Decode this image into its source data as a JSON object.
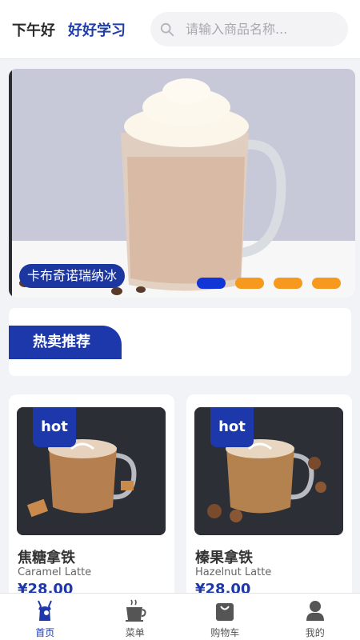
{
  "header": {
    "greeting": "下午好",
    "motto": "好好学习",
    "search_placeholder": "请输入商品名称..."
  },
  "banner": {
    "caption": "卡布奇诺瑞纳冰",
    "slide_count": 4,
    "active_slide": 1
  },
  "hot_section": {
    "title": "热卖推荐"
  },
  "products": [
    {
      "badge": "hot",
      "name": "焦糖拿铁",
      "name_en": "Caramel Latte",
      "price": "¥28.00"
    },
    {
      "badge": "hot",
      "name": "榛果拿铁",
      "name_en": "Hazelnut Latte",
      "price": "¥28.00"
    }
  ],
  "tabbar": {
    "items": [
      {
        "label": "首页",
        "icon": "home-deer-icon",
        "active": true
      },
      {
        "label": "菜单",
        "icon": "coffee-cup-icon",
        "active": false
      },
      {
        "label": "购物车",
        "icon": "shopping-bag-icon",
        "active": false
      },
      {
        "label": "我的",
        "icon": "user-icon",
        "active": false
      }
    ]
  },
  "colors": {
    "brand": "#1d38aa",
    "dot_inactive": "#f59a1f",
    "dot_active": "#1235d8"
  }
}
